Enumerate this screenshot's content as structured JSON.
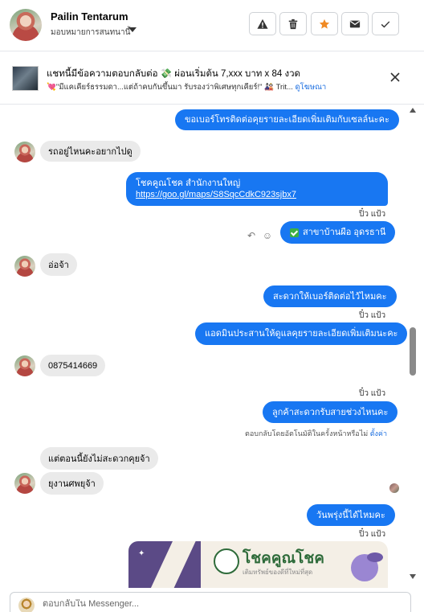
{
  "header": {
    "contact_name": "Pailin Tentarum",
    "subtitle": "มอบหมายการสนทนานี้",
    "actions": [
      {
        "icon": "warning-icon",
        "label": "Report"
      },
      {
        "icon": "trash-icon",
        "label": "Delete"
      },
      {
        "icon": "star-icon",
        "label": "Star",
        "color": "#f08a24"
      },
      {
        "icon": "mail-icon",
        "label": "Mark unread"
      },
      {
        "icon": "check-icon",
        "label": "Done"
      }
    ]
  },
  "ad": {
    "title": "แชทนี้มีข้อความตอบกลับต่อ 💸 ผ่อนเริ่มต้น 7,xxx บาท x 84 งวด",
    "description": "💘\"มีแคเคียร์ธรรมดา...แต่ถ้าคบกันขึ้นมา รับรองว่าพิเศษทุกเคียร์!\" 🎎 Trit...",
    "link": "ดูโฆษณา"
  },
  "messages": {
    "m1": "ขอเบอร์โทรติดต่อคุยรายละเอียดเพิ่มเติมกับเซลล์นะคะ",
    "m2": "รถอยู่ไหนคะอยากไปดู",
    "m3_line1": "โชคคูณโชค สำนักงานใหญ่",
    "m3_link": "https://goo.gl/maps/S8SqcCdkC923sjbx7",
    "seen1": "ปิ๋ว แป้ว",
    "m4": "สาขาบ้านผือ อุดรธานี",
    "m5": "อ่อจ้า",
    "m6": "สะดวกให้เบอร์ติดต่อไว้ไหมคะ",
    "seen2": "ปิ๋ว แป้ว",
    "m7": "แอดมินประสานให้ดูแลคุยรายละเอียดเพิ่มเติมนะคะ",
    "m8": "0875414669",
    "seen3": "ปิ๋ว แป้ว",
    "m9": "ลูกค้าสะดวกรับสายช่วงไหนคะ",
    "auto_note": "ตอบกลับโดยอัตโนมัติในครั้งหน้าหรือไม่",
    "auto_link": "ตั้งค่า",
    "m10": "แต่ตอนนี้ยังไม่สะดวกคุยจ้า",
    "m11": "ยุงานศพยุจ้า",
    "m12": "วันพรุ่งนี้ได้ไหมคะ",
    "seen4": "ปิ๋ว แป้ว"
  },
  "image_card": {
    "brand": "โชคคูณโชค",
    "tagline": "เติมทรัพย์ของดีที่ใหม่ที่สุด",
    "colors": {
      "purple": "#5b4a86",
      "green": "#2e6b3a"
    }
  },
  "composer": {
    "placeholder": "ตอบกลับใน Messenger..."
  },
  "colors": {
    "outgoing_bubble": "#1877f2",
    "incoming_bubble": "#eaeaea",
    "link": "#1b6ee0"
  }
}
